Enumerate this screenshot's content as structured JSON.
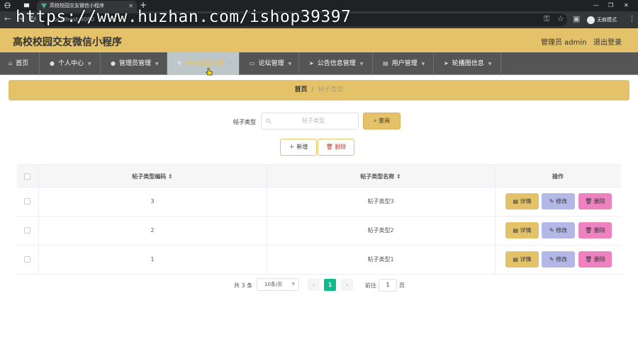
{
  "browser": {
    "tab_title": "高校校园交友微信小程序",
    "address": "localhost:8080",
    "incognito_label": "无痕模式",
    "watermark": "https://www.huzhan.com/ishop39397"
  },
  "header": {
    "title": "高校校园交友微信小程序",
    "admin_label": "管理员 admin",
    "logout_label": "退出登录"
  },
  "nav": {
    "items": [
      {
        "label": "首页",
        "icon": "home-icon"
      },
      {
        "label": "个人中心",
        "icon": "user-icon"
      },
      {
        "label": "管理员管理",
        "icon": "user-icon"
      },
      {
        "label": "帖子类型管理",
        "icon": "pin-icon",
        "active": true
      },
      {
        "label": "论坛管理",
        "icon": "forum-icon"
      },
      {
        "label": "公告信息管理",
        "icon": "send-icon"
      },
      {
        "label": "用户管理",
        "icon": "document-icon"
      },
      {
        "label": "轮播图信息",
        "icon": "send-icon"
      }
    ]
  },
  "breadcrumb": {
    "home": "首页",
    "separator": "/",
    "current": "帖子类型"
  },
  "search": {
    "label": "帖子类型",
    "placeholder": "帖子类型",
    "query_button": "查询"
  },
  "toolbar": {
    "add_button": "新增",
    "delete_button": "删除"
  },
  "table": {
    "columns": [
      "帖子类型编码",
      "帖子类型名称",
      "操作"
    ],
    "rows": [
      {
        "code": "3",
        "name": "帖子类型3"
      },
      {
        "code": "2",
        "name": "帖子类型2"
      },
      {
        "code": "1",
        "name": "帖子类型1"
      }
    ],
    "actions": {
      "detail": "详情",
      "edit": "修改",
      "delete": "删除"
    }
  },
  "pagination": {
    "total": "共 3 条",
    "page_size": "10条/页",
    "current_page": "1",
    "goto_label": "前往",
    "goto_value": "1",
    "page_unit": "页"
  },
  "colors": {
    "accent": "#e4c26a",
    "nav_bg": "#555555",
    "pager_active": "#13b98b",
    "edit": "#b3b8e6",
    "delete": "#ee82c0"
  }
}
